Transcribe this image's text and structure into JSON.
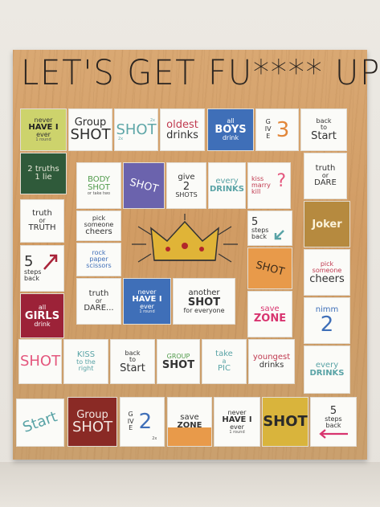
{
  "title": "LET'S GET FU**** UP",
  "tiles": {
    "never_have_1": {
      "line1": "never",
      "line2": "HAVE I",
      "line3": "ever",
      "note": "1 round"
    },
    "group_shot_1": {
      "line1": "Group",
      "line2": "SHOT"
    },
    "shot_2x": {
      "line1": "SHOT",
      "note1": "2x",
      "note2": "2x"
    },
    "oldest_drinks": {
      "line1": "oldest",
      "line2": "drinks"
    },
    "all_boys": {
      "line1": "all",
      "line2": "BOYS",
      "line3": "drink"
    },
    "give_3": {
      "line1": "GIVE",
      "line2": "3"
    },
    "back_start_1": {
      "line1": "back",
      "line2": "to",
      "line3": "Start"
    },
    "two_truth": {
      "line1": "2 truths",
      "line2": "1 lie"
    },
    "truth_dare_1": {
      "line1": "truth",
      "line2": "or",
      "line3": "DARE"
    },
    "truth_truth": {
      "line1": "truth",
      "line2": "or",
      "line3": "TRUTH"
    },
    "joker": {
      "line1": "Joker"
    },
    "five_back_arrow": {
      "line1": "5",
      "line2": "steps",
      "line3": "back"
    },
    "pick_cheers_1": {
      "line1": "pick",
      "line2": "someone",
      "line3": "cheers"
    },
    "all_girls": {
      "line1": "all",
      "line2": "GIRLS",
      "line3": "drink"
    },
    "nimm_2": {
      "line1": "nimm",
      "line2": "2"
    },
    "shot_pink": {
      "line1": "SHOT"
    },
    "every_drinks_1": {
      "line1": "every",
      "line2": "DRINKS"
    },
    "start": {
      "line1": "Start"
    },
    "group_shot_2": {
      "line1": "Group",
      "line2": "SHOT"
    },
    "give_2_bottom": {
      "line1": "GIVE",
      "line2": "2",
      "note": "2x"
    },
    "save_zone_1": {
      "line1": "save",
      "line2": "ZONE"
    },
    "never_have_2": {
      "line1": "never",
      "line2": "HAVE I",
      "line3": "ever",
      "note": "1 round"
    },
    "shot_yellow": {
      "line1": "SHOT"
    },
    "five_back_2": {
      "line1": "5",
      "line2": "steps",
      "line3": "back"
    },
    "kiss_right": {
      "line1": "KISS",
      "line2": "to the",
      "line3": "right"
    },
    "back_start_2": {
      "line1": "back",
      "line2": "to",
      "line3": "Start"
    },
    "group_shot_green": {
      "line1": "GROUP",
      "line2": "SHOT"
    },
    "take_pic": {
      "line1": "take",
      "line2": "a",
      "line3": "PIC"
    },
    "youngest_drinks": {
      "line1": "youngest",
      "line2": "drinks"
    },
    "body_shot": {
      "line1": "BODY",
      "line2": "SHOT",
      "note": "or take two"
    },
    "shot_purple": {
      "line1": "SHOT"
    },
    "give_2_shots": {
      "line1": "give",
      "line2": "2",
      "line3": "SHOTS"
    },
    "every_drinks_2": {
      "line1": "every",
      "line2": "DRINKS"
    },
    "kiss_marry_kill": {
      "line1": "kiss",
      "line2": "marry",
      "line3": "kill"
    },
    "pick_cheers_2": {
      "line1": "pick",
      "line2": "someone",
      "line3": "cheers"
    },
    "five_back_3": {
      "line1": "5",
      "line2": "steps",
      "line3": "back"
    },
    "rock_paper": {
      "line1": "rock",
      "line2": "paper",
      "line3": "scissors"
    },
    "shot_orange": {
      "line1": "SHOT"
    },
    "truth_dare_2": {
      "line1": "truth",
      "line2": "or",
      "line3": "DARE..."
    },
    "never_have_3": {
      "line1": "never",
      "line2": "HAVE I",
      "line3": "ever",
      "note": "1 round"
    },
    "another_shot": {
      "line1": "another",
      "line2": "SHOT",
      "line3": "for everyone"
    },
    "save_zone_2": {
      "line1": "save",
      "line2": "ZONE"
    }
  },
  "colors": {
    "wood": "#d3a06a",
    "green_light": "#c9d36a",
    "green_dark": "#2f5a3a",
    "blue": "#3f6fb8",
    "purple": "#6b63ad",
    "crimson": "#9c2238",
    "olive": "#b68a3f",
    "brown_red": "#8a2a25",
    "yellow": "#d9b43c",
    "orange": "#e89a4a",
    "pink": "#e4577e",
    "teal": "#59a3a6",
    "magenta": "#d8346f"
  }
}
